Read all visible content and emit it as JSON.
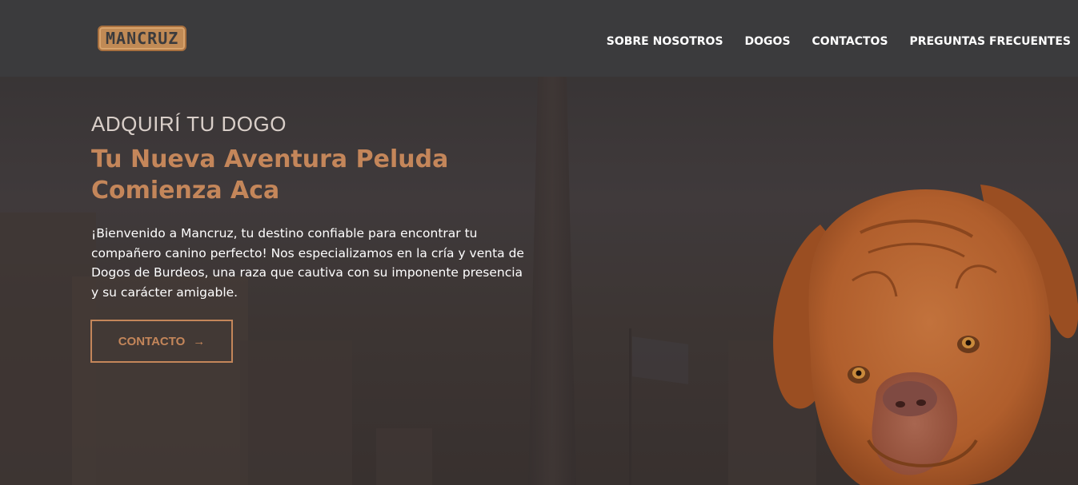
{
  "header": {
    "logo_text": "MANCRUZ",
    "nav": [
      "SOBRE NOSOTROS",
      "DOGOS",
      "CONTACTOS",
      "PREGUNTAS FRECUENTES"
    ]
  },
  "hero": {
    "eyebrow": "ADQUIRÍ TU DOGO",
    "title_line1": "Tu Nueva Aventura Peluda",
    "title_line2": "Comienza Aca",
    "description": "¡Bienvenido a Mancruz, tu destino confiable para encontrar tu compañero canino perfecto! Nos especializamos en la cría y venta de Dogos de Burdeos, una raza que cautiva con su imponente presencia y su carácter amigable.",
    "cta_label": "CONTACTO",
    "cta_icon": "arrow-right-icon"
  },
  "colors": {
    "accent": "#c4865a",
    "header_bg": "#3b3b3d",
    "text": "#ffffff"
  }
}
